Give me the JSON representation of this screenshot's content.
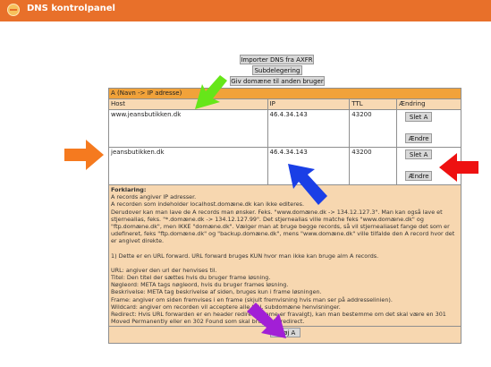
{
  "app": {
    "title": "DNS kontrolpanel",
    "logo_icon": "orange-circle-logo-icon"
  },
  "toolbar": {
    "import_label": "Importer DNS fra AXFR",
    "subdelegation_label": "Subdelegering",
    "give_domain_label": "Giv domæne til anden bruger"
  },
  "section": {
    "title": "A (Navn -> IP adresse)",
    "columns": {
      "host": "Host",
      "ip": "IP",
      "ttl": "TTL",
      "change": "Ændring"
    },
    "rows": [
      {
        "host": "www.jeansbutikken.dk",
        "ip": "46.4.34.143",
        "ttl": "43200",
        "delete_label": "Slet A",
        "change_label": "Ændre"
      },
      {
        "host": "jeansbutikken.dk",
        "ip": "46.4.34.143",
        "ttl": "43200",
        "delete_label": "Slet A",
        "change_label": "Ændre"
      }
    ],
    "add_label": "Tilføj A"
  },
  "explanation": {
    "heading": "Forklaring:",
    "lines": [
      "A records angiver IP adresser.",
      "A recorden som indeholder localhost.domæne.dk kan ikke editeres.",
      "Derudover kan man lave de A records man ønsker. Feks. \"www.domæne.dk -> 134.12.127.3\". Man kan også lave et stjernealias, feks. \"*.domæne.dk -> 134.12.127.99\". Det stjernealias ville matche feks \"www.domæne.dk\" og \"ftp.domæne.dk\", men IKKE \"domæne.dk\". Vælger man at bruge begge records, så vil stjernealiaset fange det som er udefineret, feks \"ftp.domæne.dk\" og \"backup.domæne.dk\", mens \"www.domæne.dk\" ville tilfalde den A record hvor det er angivet direkte.",
      "",
      "1) Dette er en URL forward. URL forward bruges KUN hvor man ikke kan bruge alm A records.",
      "",
      "URL: angiver den url der henvises til.",
      "Titel: Den titel der sættes hvis du bruger frame løsning.",
      "Nøgleord: META tags nøgleord, hvis du bruger frames løsning.",
      "Beskrivelse: META tag beskrivelse af siden, bruges kun i frame løsningen.",
      "Frame: angiver om siden fremvises i en frame (skjult fremvisning hvis man ser på addresselinien).",
      "Wildcard: angiver om recorden vil acceptere alle URL subdomæne henvisninger.",
      "Redirect: Hvis URL forwarden er en header redirect (frame er fravalgt), kan man bestemme om det skal være en 301 Moved Permanently eller en 302 Found som skal bruges til redirect."
    ]
  },
  "annotations": {
    "colors": {
      "green": "#66e619",
      "orange": "#f57a1f",
      "red": "#ee1111",
      "blue": "#1a3fe6",
      "purple": "#a21fd6"
    }
  }
}
